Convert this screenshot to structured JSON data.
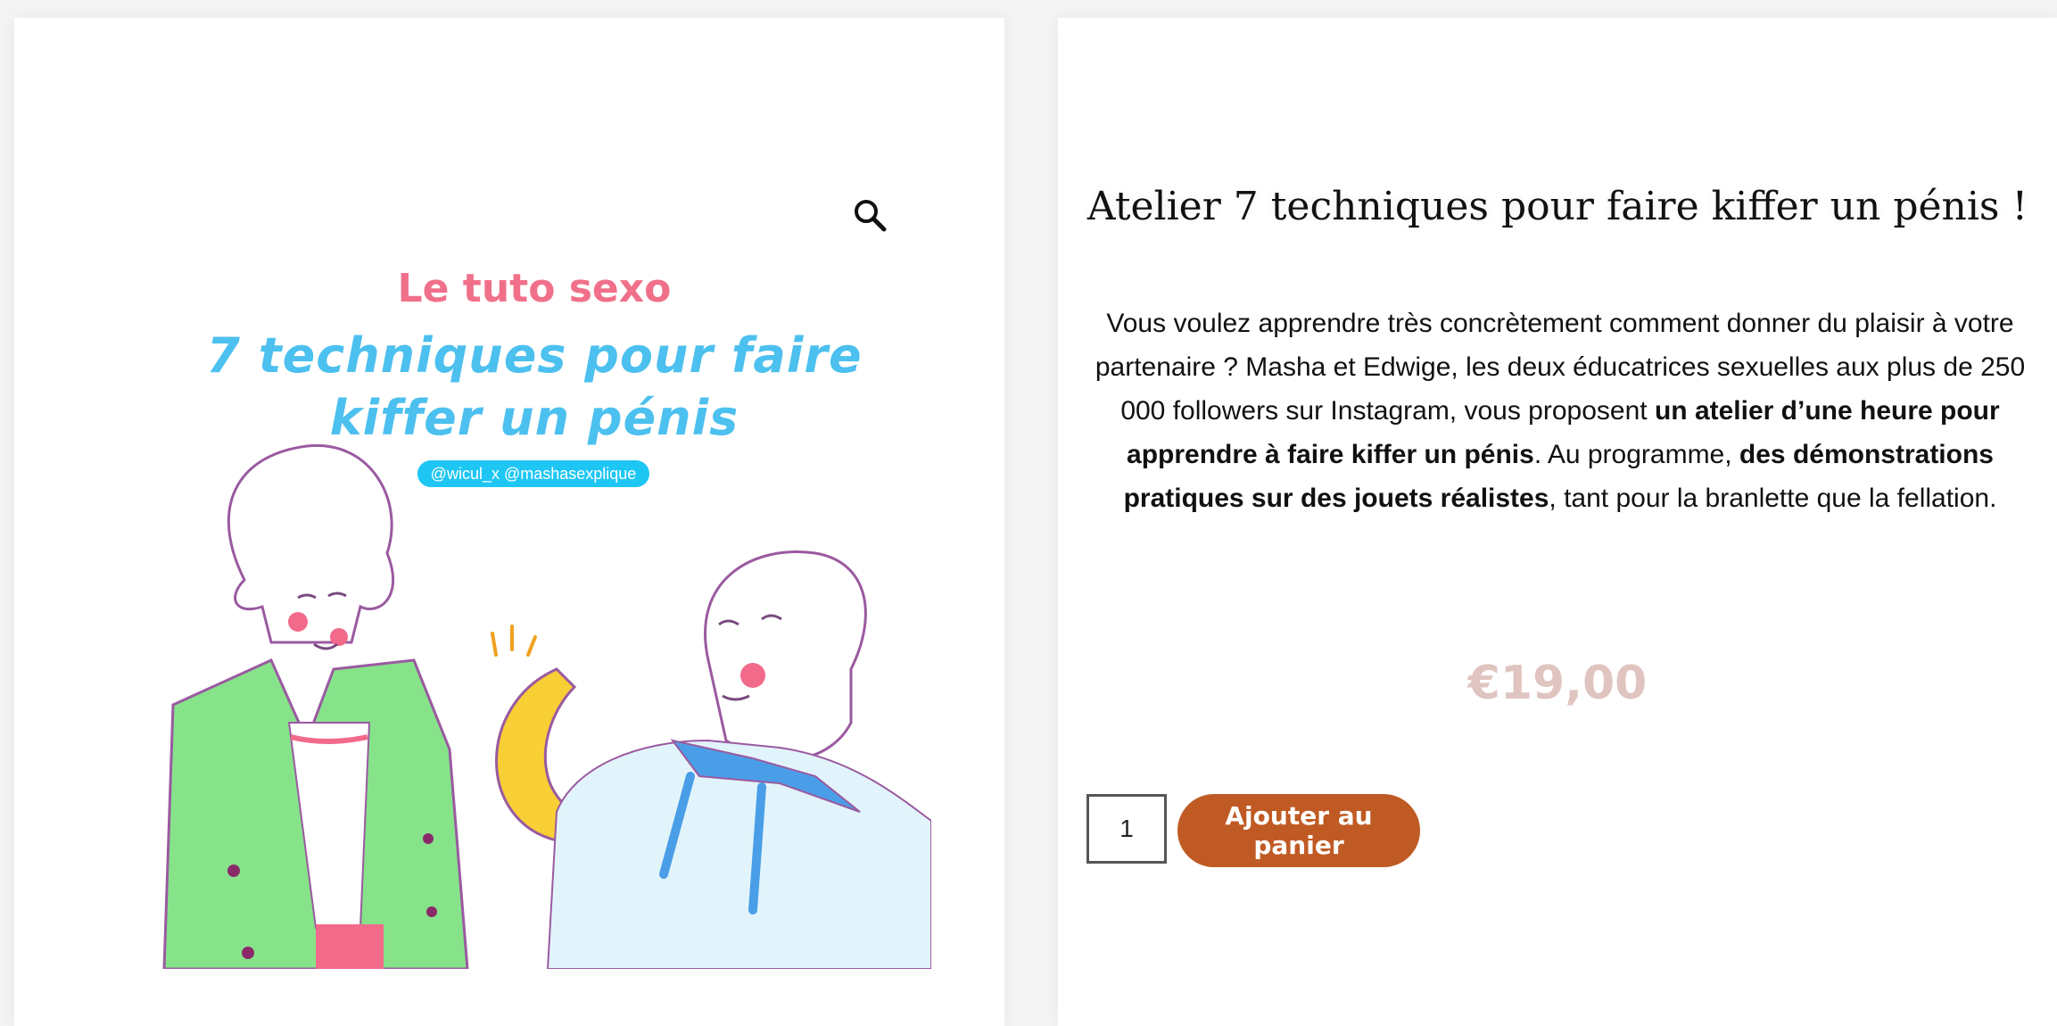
{
  "image": {
    "kicker": "Le tuto sexo",
    "title_line1": "7 techniques pour faire",
    "title_line2": "kiffer un pénis",
    "handles": "@wicul_x @mashasexplique",
    "colors": {
      "kicker": "#f0708a",
      "title": "#4cc0ef",
      "badge": "#1ec6f3",
      "jacket": "#86e38a",
      "hoodie": "#e2f4fb",
      "banana": "#f8cf35"
    }
  },
  "product": {
    "title": "Atelier 7 techniques pour faire kiffer un pénis !",
    "description": {
      "part1": "Vous voulez apprendre très concrètement comment donner du plaisir à votre partenaire ? Masha et Edwige, les deux éducatrices sexuelles aux plus de 250 000 followers sur Instagram, vous proposent ",
      "bold1": "un atelier d’une heure pour apprendre à faire kiffer un pénis",
      "part2": ". Au programme, ",
      "bold2": "des démonstrations pratiques sur des jouets réalistes",
      "part3": ", tant pour la branlette que la fellation."
    },
    "price": "€19,00",
    "quantity": "1",
    "add_to_cart_label": "Ajouter au panier",
    "colors": {
      "price": "#e0c4c0",
      "button": "#c05a24"
    }
  },
  "icons": {
    "zoom": "search-icon"
  }
}
